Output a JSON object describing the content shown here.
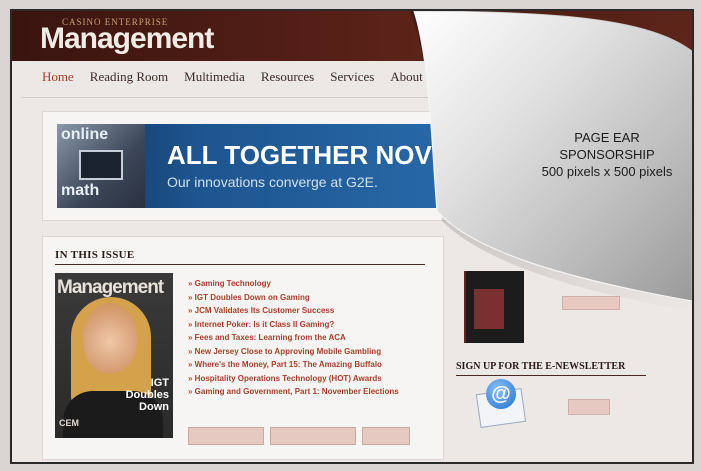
{
  "header": {
    "brand_small": "Casino Enterprise",
    "brand_big": "Management"
  },
  "nav": {
    "items": [
      "Home",
      "Reading Room",
      "Multimedia",
      "Resources",
      "Services",
      "About C"
    ]
  },
  "banner": {
    "left_top": "online",
    "left_bottom": "math",
    "title": "ALL TOGETHER NOV",
    "subtitle": "Our innovations converge at G2E."
  },
  "issue": {
    "title": "IN THIS ISSUE",
    "cover_title": "Management",
    "cover_headline": "IGT Doubles Down",
    "cover_logo": "CEM",
    "articles": [
      "Gaming Technology",
      "IGT Doubles Down on Gaming",
      "JCM Validates Its Customer Success",
      "Internet Poker: Is it Class II Gaming?",
      "Fees and Taxes: Learning from the ACA",
      "New Jersey Close to Approving Mobile Gambling",
      "Where's the Money, Part 15: The Amazing Buffalo",
      "Hospitality Operations Technology (HOT) Awards",
      "Gaming and Government, Part 1: November Elections"
    ]
  },
  "sidebar": {
    "signup_title": "SIGN UP FOR THE E-NEWSLETTER",
    "at_symbol": "@"
  },
  "page_ear": {
    "line1": "PAGE EAR",
    "line2": "SPONSORSHIP",
    "line3": "500 pixels x 500 pixels"
  }
}
